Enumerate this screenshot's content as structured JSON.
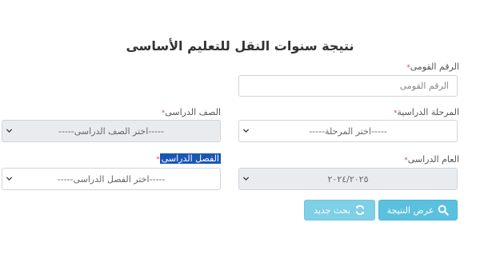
{
  "page": {
    "title": "نتيجة سنوات النقل للتعليم الأساسى"
  },
  "fields": {
    "national_id": {
      "label": "الرقم القومى",
      "placeholder": "الرقم القومى"
    },
    "stage": {
      "label": "المرحلة الدراسية",
      "selected": "-----اختر المرحلة-----"
    },
    "grade": {
      "label": "الصف الدراسى",
      "selected": "-----اختر الصف الدراسى-----"
    },
    "year": {
      "label": "العام الدراسى",
      "selected": "٢٠٢٤/٢٠٢٥"
    },
    "term": {
      "label": "الفصل الدراسى",
      "selected": "-----اختر الفصل الدراسى-----"
    }
  },
  "required_mark": "*",
  "buttons": {
    "show_result": "عرض النتيجة",
    "new_search": "بحث جديد"
  },
  "icons": {
    "search": "search-icon",
    "refresh": "refresh-icon",
    "chevron": "chevron-down-icon"
  },
  "colors": {
    "button_primary": "#5bc0de",
    "button_secondary": "#7fcfe6",
    "required": "#d9534f",
    "selection_highlight": "#1a56b8"
  }
}
